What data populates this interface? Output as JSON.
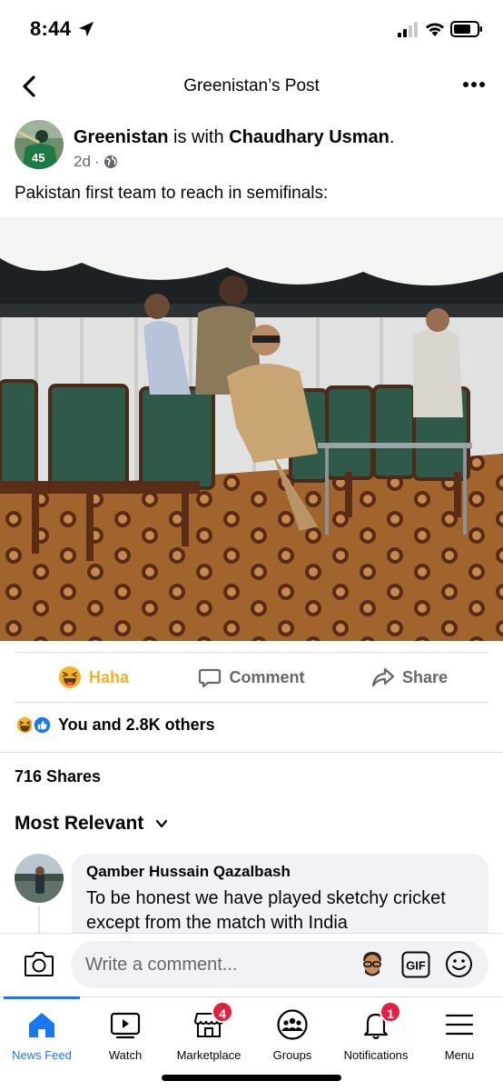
{
  "status_bar": {
    "time": "8:44"
  },
  "header": {
    "title": "Greenistan’s Post"
  },
  "post": {
    "author": "Greenistan",
    "with_word": "is with",
    "tagged": "Chaudhary Usman",
    "time": "2d",
    "avatar_jersey_number": "45",
    "text": "Pakistan first team to reach in semifinals:"
  },
  "actions": {
    "reaction": "Haha",
    "comment": "Comment",
    "share": "Share"
  },
  "reactions_summary": "You and 2.8K others",
  "shares": "716 Shares",
  "sort": {
    "label": "Most Relevant"
  },
  "comments": [
    {
      "author": "Qamber Hussain Qazalbash",
      "text": "To be honest we have played sketchy cricket except from the match with India"
    }
  ],
  "composer": {
    "placeholder": "Write a comment...",
    "gif_label": "GIF"
  },
  "tabs": [
    {
      "label": "News Feed",
      "icon": "home-icon"
    },
    {
      "label": "Watch",
      "icon": "watch-icon"
    },
    {
      "label": "Marketplace",
      "icon": "marketplace-icon",
      "badge": "4"
    },
    {
      "label": "Groups",
      "icon": "groups-icon"
    },
    {
      "label": "Notifications",
      "icon": "bell-icon",
      "badge": "1"
    },
    {
      "label": "Menu",
      "icon": "menu-icon"
    }
  ],
  "colors": {
    "accent": "#1877f2",
    "haha": "#f7b125",
    "badge": "#e41e3f",
    "muted": "#65676b"
  }
}
